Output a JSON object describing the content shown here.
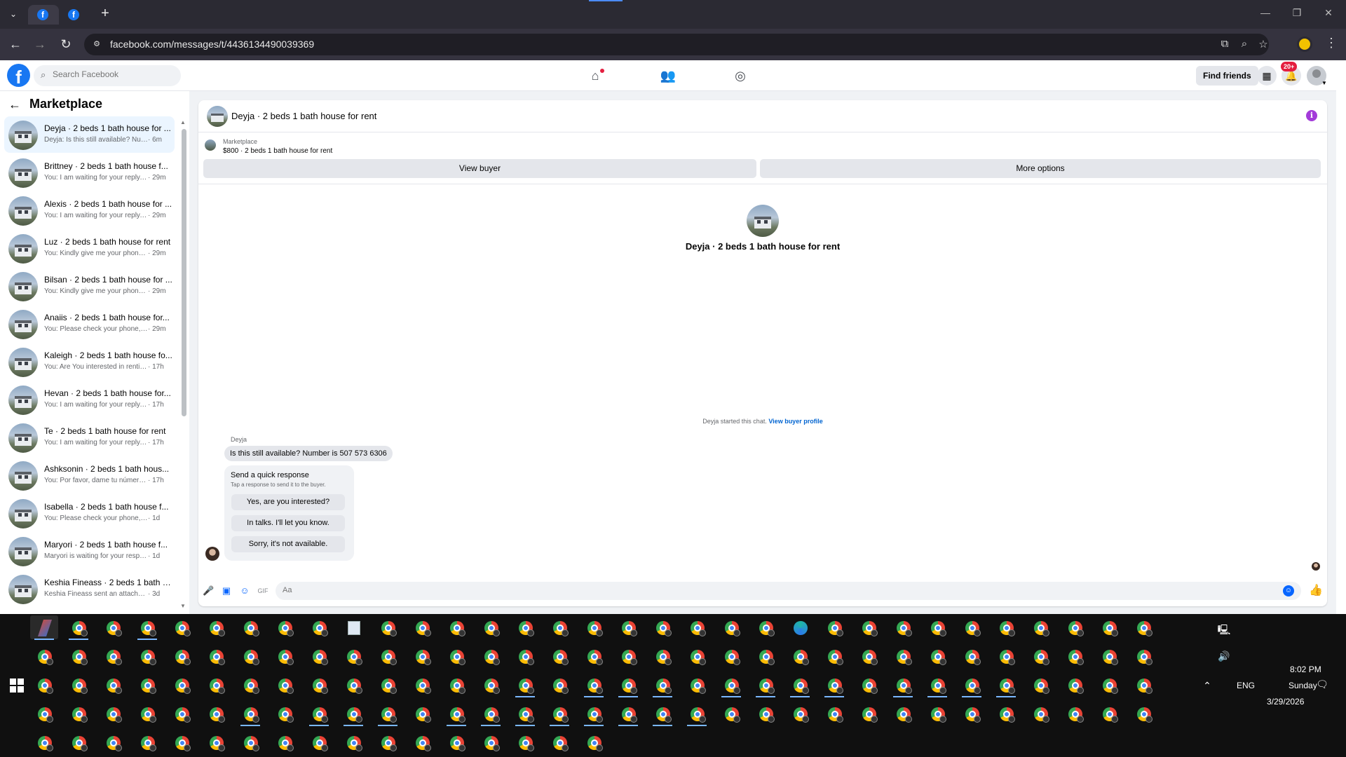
{
  "browser": {
    "url": "facebook.com/messages/t/4436134490039369"
  },
  "fb_nav": {
    "search_placeholder": "Search Facebook",
    "find_friends": "Find friends",
    "notification_badge": "20+"
  },
  "sidebar": {
    "title": "Marketplace",
    "conversations": [
      {
        "name": "Deyja · 2 beds 1 bath house for ...",
        "snippet": "Deyja: Is this still available? Numb...",
        "time": "· 6m"
      },
      {
        "name": "Brittney · 2 beds 1 bath house f...",
        "snippet": "You: I am waiting for your reply, ...",
        "time": "· 29m"
      },
      {
        "name": "Alexis · 2 beds 1 bath house for ...",
        "snippet": "You: I am waiting for your reply, ...",
        "time": "· 29m"
      },
      {
        "name": "Luz · 2 beds 1 bath house for rent",
        "snippet": "You: Kindly give me your phone ...",
        "time": "· 29m"
      },
      {
        "name": "Bilsan · 2 beds 1 bath house for ...",
        "snippet": "You: Kindly give me your phone ...",
        "time": "· 29m"
      },
      {
        "name": "Anaiis · 2 beds 1 bath house for...",
        "snippet": "You: Please check your phone, I ...",
        "time": "· 29m"
      },
      {
        "name": "Kaleigh · 2 beds 1 bath house fo...",
        "snippet": "You: Are You interested in renting...",
        "time": "· 17h"
      },
      {
        "name": "Hevan · 2 beds 1 bath house for...",
        "snippet": "You: I am waiting for your reply, ...",
        "time": "· 17h"
      },
      {
        "name": "Te · 2 beds 1 bath house for rent",
        "snippet": "You: I am waiting for your reply, ...",
        "time": "· 17h"
      },
      {
        "name": "Ashksonin · 2 beds 1 bath hous...",
        "snippet": "You: Por favor, dame tu número ...",
        "time": "· 17h"
      },
      {
        "name": "Isabella · 2 beds 1 bath house f...",
        "snippet": "You: Please check your phone, I ha...",
        "time": "· 1d"
      },
      {
        "name": "Maryori · 2 beds 1 bath house f...",
        "snippet": "Maryori is waiting for your respon...",
        "time": "· 1d"
      },
      {
        "name": "Keshia Fineass · 2 beds 1 bath h...",
        "snippet": "Keshia Fineass sent an attachment.",
        "time": "· 3d"
      }
    ]
  },
  "chat": {
    "header_title": "Deyja · 2 beds 1 bath house for rent",
    "marketplace_label": "Marketplace",
    "listing": "$800 · 2 beds 1 bath house for rent",
    "view_buyer": "View buyer",
    "more_options": "More options",
    "center_title": "Deyja · 2 beds 1 bath house for rent",
    "started_text": "Deyja started this chat.",
    "view_buyer_profile": "View buyer profile",
    "sender": "Deyja",
    "message": "Is this still available? Number is 507 573 6306",
    "quick_title": "Send a quick response",
    "quick_subtitle": "Tap a response to send it to the buyer.",
    "quick_options": [
      "Yes, are you interested?",
      "In talks. I'll let you know.",
      "Sorry, it's not available."
    ],
    "composer_placeholder": "Aa"
  },
  "taskbar": {
    "language": "ENG",
    "time": "8:02 PM",
    "day": "Sunday",
    "date": "3/29/2026"
  }
}
